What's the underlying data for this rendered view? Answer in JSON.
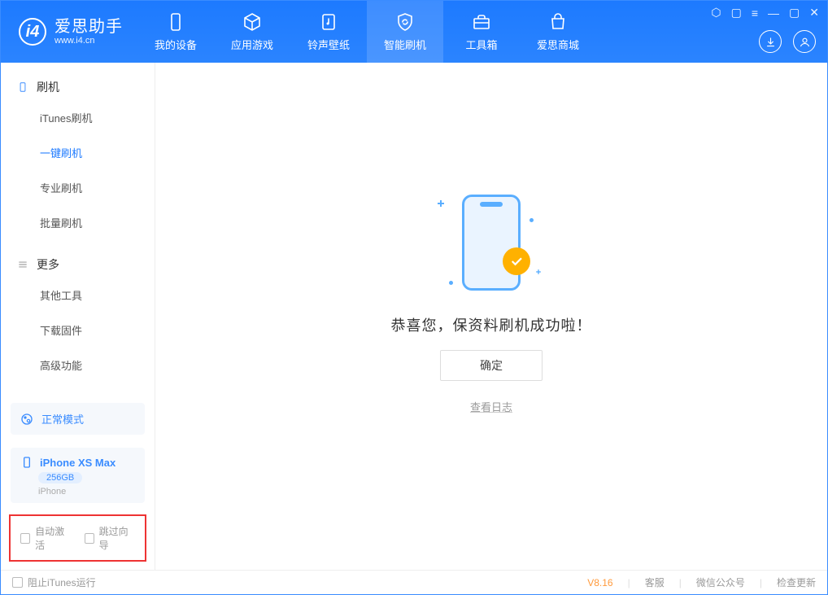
{
  "header": {
    "logo_title": "爱思助手",
    "logo_sub": "www.i4.cn",
    "nav": [
      {
        "label": "我的设备"
      },
      {
        "label": "应用游戏"
      },
      {
        "label": "铃声壁纸"
      },
      {
        "label": "智能刷机"
      },
      {
        "label": "工具箱"
      },
      {
        "label": "爱思商城"
      }
    ]
  },
  "sidebar": {
    "flash_section": {
      "title": "刷机",
      "items": [
        {
          "label": "iTunes刷机"
        },
        {
          "label": "一键刷机"
        },
        {
          "label": "专业刷机"
        },
        {
          "label": "批量刷机"
        }
      ]
    },
    "more_section": {
      "title": "更多",
      "items": [
        {
          "label": "其他工具"
        },
        {
          "label": "下载固件"
        },
        {
          "label": "高级功能"
        }
      ]
    },
    "mode_label": "正常模式",
    "device": {
      "name": "iPhone XS Max",
      "capacity": "256GB",
      "type": "iPhone"
    },
    "checkbox1": "自动激活",
    "checkbox2": "跳过向导"
  },
  "main": {
    "success_text": "恭喜您，保资料刷机成功啦！",
    "ok_button": "确定",
    "log_link": "查看日志"
  },
  "footer": {
    "block_itunes": "阻止iTunes运行",
    "version": "V8.16",
    "link_support": "客服",
    "link_wechat": "微信公众号",
    "link_update": "检查更新"
  }
}
